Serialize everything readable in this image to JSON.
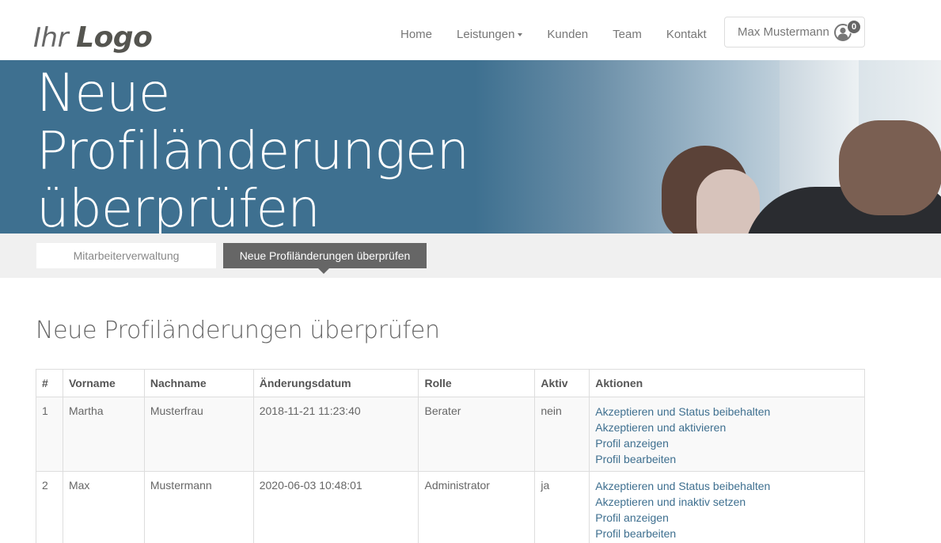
{
  "header": {
    "logo": {
      "light": "Ihr",
      "bold": "Logo"
    },
    "nav": [
      {
        "label": "Home",
        "has_dropdown": false
      },
      {
        "label": "Leistungen",
        "has_dropdown": true
      },
      {
        "label": "Kunden",
        "has_dropdown": false
      },
      {
        "label": "Team",
        "has_dropdown": false
      },
      {
        "label": "Kontakt",
        "has_dropdown": false
      }
    ],
    "user": {
      "name": "Max Mustermann",
      "icon": "user-circle-icon",
      "notification_count": "0"
    }
  },
  "hero": {
    "title_lines": [
      "Neue",
      "Profiländerungen",
      "überprüfen"
    ]
  },
  "breadcrumb": [
    {
      "label": "Mitarbeiterverwaltung",
      "active": false
    },
    {
      "label": "Neue Profiländerungen überprüfen",
      "active": true
    }
  ],
  "main": {
    "heading": "Neue Profiländerungen überprüfen",
    "table": {
      "columns": [
        "#",
        "Vorname",
        "Nachname",
        "Änderungsdatum",
        "Rolle",
        "Aktiv",
        "Aktionen"
      ],
      "rows": [
        {
          "num": "1",
          "vorname": "Martha",
          "nachname": "Musterfrau",
          "datum": "2018-11-21 11:23:40",
          "rolle": "Berater",
          "aktiv": "nein",
          "actions": [
            "Akzeptieren und Status beibehalten",
            "Akzeptieren und aktivieren",
            "Profil anzeigen",
            "Profil bearbeiten"
          ]
        },
        {
          "num": "2",
          "vorname": "Max",
          "nachname": "Mustermann",
          "datum": "2020-06-03 10:48:01",
          "rolle": "Administrator",
          "aktiv": "ja",
          "actions": [
            "Akzeptieren und Status beibehalten",
            "Akzeptieren und inaktiv setzen",
            "Profil anzeigen",
            "Profil bearbeiten"
          ]
        }
      ]
    }
  },
  "colors": {
    "hero_blue": "#3e7090",
    "link": "#3e6f8f",
    "active_crumb": "#666666",
    "band": "#f0f0f0"
  }
}
